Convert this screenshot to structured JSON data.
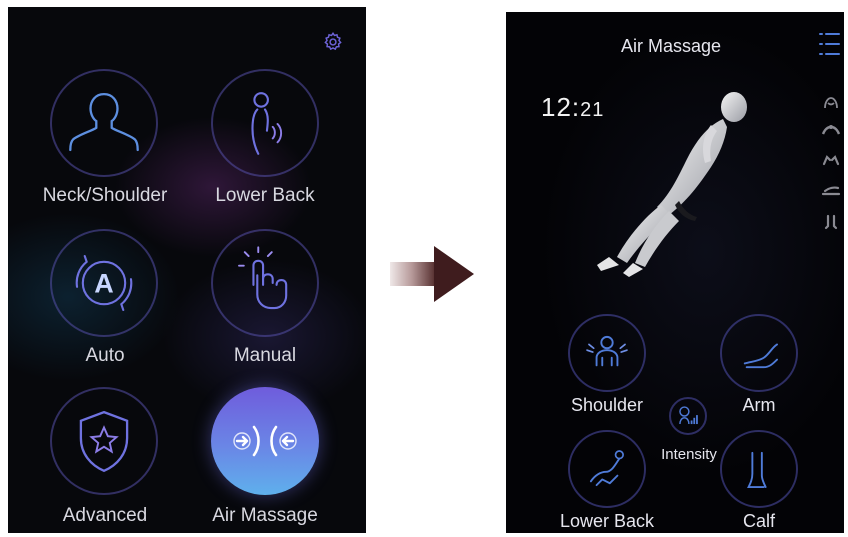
{
  "left_panel": {
    "modes": [
      {
        "label": "Neck/Shoulder",
        "icon": "neck-shoulder-icon"
      },
      {
        "label": "Lower Back",
        "icon": "lower-back-icon"
      },
      {
        "label": "Auto",
        "icon": "auto-icon",
        "icon_text": "A"
      },
      {
        "label": "Manual",
        "icon": "manual-icon"
      },
      {
        "label": "Advanced",
        "icon": "advanced-shield-icon"
      },
      {
        "label": "Air Massage",
        "icon": "air-massage-icon",
        "selected": true
      }
    ],
    "settings_icon": "gear-icon",
    "colors": {
      "ring": "#5550aa",
      "selected_top": "#6f5cdc",
      "selected_bottom": "#5fb0ec"
    }
  },
  "arrow_icon": "right-arrow-icon",
  "right_panel": {
    "title": "Air Massage",
    "clock": {
      "hour": "12",
      "minute": "21"
    },
    "menu_icon": "list-menu-icon",
    "side_icons": [
      "seat-icon",
      "back-icon",
      "hands-icon",
      "recline-icon",
      "legs-icon"
    ],
    "chair_figure": "reclining-body-figure",
    "controls": [
      {
        "label": "Shoulder",
        "icon": "shoulder-icon"
      },
      {
        "label": "Arm",
        "icon": "arm-icon"
      },
      {
        "label": "Intensity",
        "icon": "intensity-icon"
      },
      {
        "label": "Lower Back",
        "icon": "lower-back-icon"
      },
      {
        "label": "Calf",
        "icon": "calf-icon"
      }
    ],
    "colors": {
      "accent": "#4f7bd8",
      "ring": "#4a4aa0"
    }
  }
}
